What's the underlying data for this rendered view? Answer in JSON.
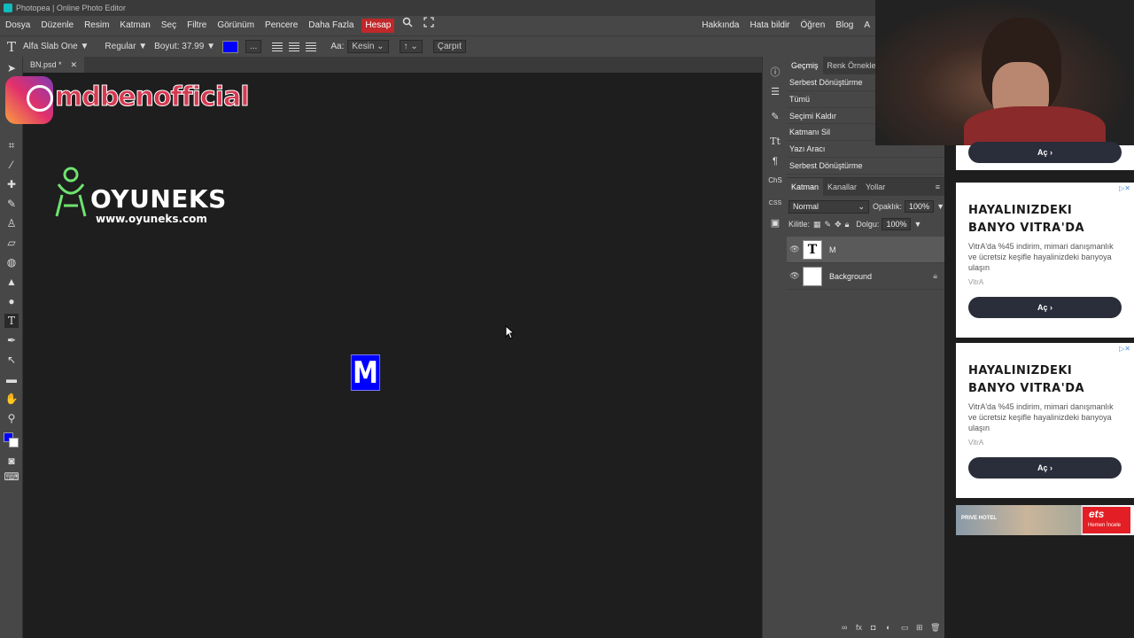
{
  "window": {
    "title": "Photopea | Online Photo Editor"
  },
  "menu": {
    "items": [
      "Dosya",
      "Düzenle",
      "Resim",
      "Katman",
      "Seç",
      "Filtre",
      "Görünüm",
      "Pencere",
      "Daha Fazla"
    ],
    "highlight": "Hesap",
    "right_items": [
      "Hakkında",
      "Hata bildir",
      "Öğren",
      "Blog",
      "A"
    ]
  },
  "options": {
    "tool_glyph": "T",
    "font_family": "Alfa Slab One",
    "font_style": "Regular",
    "size_label": "Boyut:",
    "size_value": "37.99",
    "text_color": "#0000ff",
    "more_label": "...",
    "aa_label": "Aa:",
    "aa_value": "Kesin",
    "warp_value": "↑",
    "cancel_label": "Çarpıt"
  },
  "doc": {
    "tab_name": "BN.psd *",
    "close_glyph": "✕"
  },
  "overlays": {
    "instagram_handle": "mdbenofficial",
    "brand_name": "OYUNEKS",
    "brand_url": "www.oyuneks.com"
  },
  "canvas": {
    "text_layer_content": "M"
  },
  "history": {
    "tabs": [
      "Geçmiş",
      "Renk Örnekle"
    ],
    "items": [
      "Serbest Dönüştürme",
      "Tümü",
      "Seçimi Kaldır",
      "Katmanı Sil",
      "Yazı Aracı",
      "Serbest Dönüştürme"
    ]
  },
  "layers": {
    "tabs": [
      "Katman",
      "Kanallar",
      "Yollar"
    ],
    "blend_mode": "Normal",
    "opacity_label": "Opaklık:",
    "opacity_value": "100%",
    "lock_label": "Kilitle:",
    "fill_label": "Dolgu:",
    "fill_value": "100%",
    "rows": [
      {
        "name": "M",
        "thumb": "T"
      },
      {
        "name": "Background",
        "thumb": ""
      }
    ]
  },
  "ads": {
    "top_button": "Aç",
    "cards": [
      {
        "title_line1": "HAYALINIZDEKI",
        "title_line2": "BANYO VITRA'DA",
        "desc": "VitrA'da %45 indirim, mimari danışmanlık ve ücretsiz keşifle hayalinizdeki banyoya ulaşın",
        "brand": "VitrA",
        "button": "Aç"
      },
      {
        "title_line1": "HAYALINIZDEKI",
        "title_line2": "BANYO VITRA'DA",
        "desc": "VitrA'da %45 indirim, mimari danışmanlık ve ücretsiz keşifle hayalinizdeki banyoya ulaşın",
        "brand": "VitrA",
        "button": "Aç"
      }
    ],
    "banner_left": "PRIVE HOTEL",
    "banner_brand": "ets",
    "banner_cta": "Hemen İncele"
  }
}
